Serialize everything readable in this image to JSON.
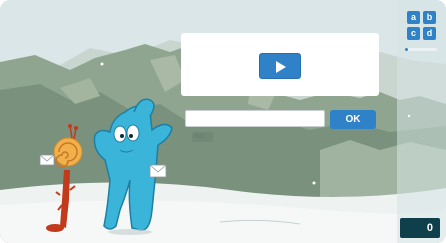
{
  "video": {
    "play_icon": "play-icon"
  },
  "answer": {
    "value": "",
    "placeholder": ""
  },
  "ok_label": "OK",
  "accent_label": "éàç...",
  "letters": {
    "a": "a",
    "b": "b",
    "c": "c",
    "d": "d",
    "icon": "abcd-grid-icon"
  },
  "progress": {
    "fraction": 0.1
  },
  "score": "0",
  "colors": {
    "accent": "#2f82c8",
    "score_bg": "#0e3f4a"
  }
}
